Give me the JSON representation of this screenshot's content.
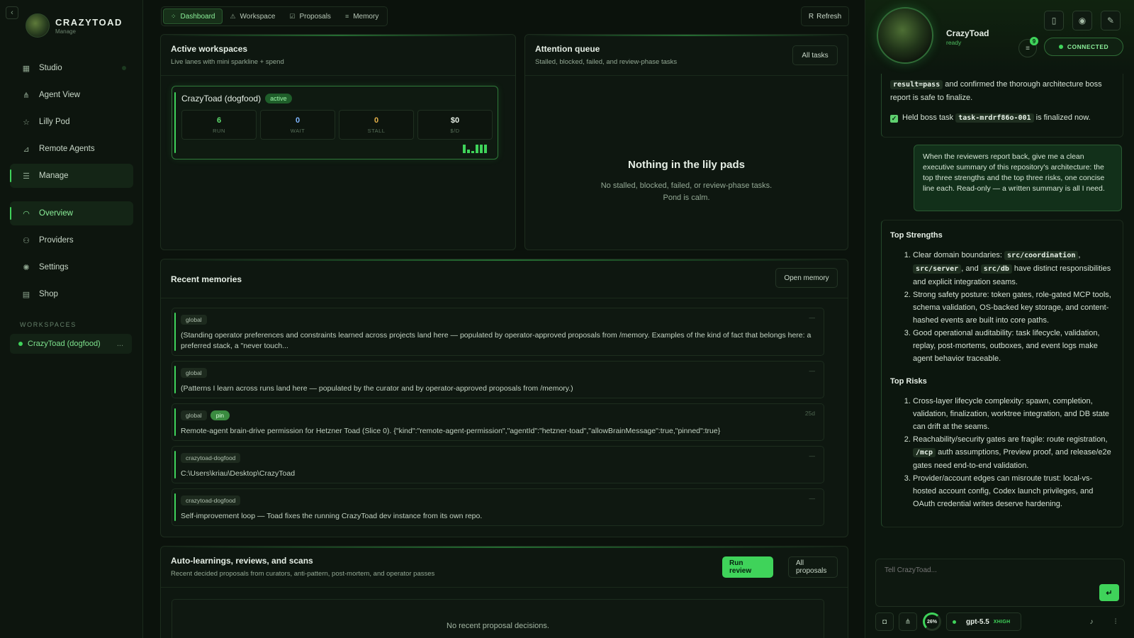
{
  "sidebar": {
    "collapse_icon": "chevron-left-icon",
    "brand": {
      "name": "CRAZYTOAD",
      "subtitle": "Manage"
    },
    "nav_top": [
      {
        "label": "Studio",
        "icon": "grid-icon"
      },
      {
        "label": "Agent View",
        "icon": "nodes-icon"
      },
      {
        "label": "Lilly Pod",
        "icon": "star-icon"
      },
      {
        "label": "Remote Agents",
        "icon": "antenna-icon"
      },
      {
        "label": "Manage",
        "icon": "sliders-icon"
      }
    ],
    "nav_bottom": [
      {
        "label": "Overview",
        "icon": "gauge-icon"
      },
      {
        "label": "Providers",
        "icon": "users-icon"
      },
      {
        "label": "Settings",
        "icon": "gear-icon"
      },
      {
        "label": "Shop",
        "icon": "store-icon"
      }
    ],
    "workspaces_label": "WORKSPACES",
    "workspace_item": {
      "label": "CrazyToad (dogfood)",
      "more": "..."
    }
  },
  "tabs": [
    {
      "label": "Dashboard",
      "icon": "dashboard-icon",
      "active": true
    },
    {
      "label": "Workspace",
      "icon": "workspace-icon",
      "active": false
    },
    {
      "label": "Proposals",
      "icon": "checkbox-icon",
      "active": false
    },
    {
      "label": "Memory",
      "icon": "list-icon",
      "active": false
    }
  ],
  "refresh_label": "Refresh",
  "active_workspaces": {
    "title": "Active workspaces",
    "subtitle": "Live lanes with mini sparkline + spend",
    "card": {
      "name": "CrazyToad (dogfood)",
      "status": "active",
      "stats": [
        {
          "value": "6",
          "label": "RUN",
          "color": "#5fe06f"
        },
        {
          "value": "0",
          "label": "WAIT",
          "color": "#7fb6ff"
        },
        {
          "value": "0",
          "label": "STALL",
          "color": "#e6b14a"
        },
        {
          "value": "$0",
          "label": "$/D",
          "color": "#e6efe6"
        }
      ]
    }
  },
  "attention_queue": {
    "title": "Attention queue",
    "subtitle": "Stalled, blocked, failed, and review-phase tasks",
    "button": "All tasks",
    "empty_title": "Nothing in the lily pads",
    "empty_line1": "No stalled, blocked, failed, or review-phase tasks.",
    "empty_line2": "Pond is calm."
  },
  "recent_memories": {
    "title": "Recent memories",
    "button": "Open memory",
    "items": [
      {
        "tags": [
          "global"
        ],
        "pin": "",
        "meta": "—",
        "text": "(Standing operator preferences and constraints learned across projects land here — populated by operator-approved proposals from /memory. Examples of the kind of fact that belongs here: a preferred stack, a \"never touch..."
      },
      {
        "tags": [
          "global"
        ],
        "pin": "",
        "meta": "—",
        "text": "(Patterns I learn across runs land here — populated by the curator and by operator-approved proposals from /memory.)"
      },
      {
        "tags": [
          "global"
        ],
        "pin": "pin",
        "meta": "25d",
        "text": "Remote-agent brain-drive permission for Hetzner Toad (Slice 0). {\"kind\":\"remote-agent-permission\",\"agentId\":\"hetzner-toad\",\"allowBrainMessage\":true,\"pinned\":true}"
      },
      {
        "tags": [
          "crazytoad-dogfood"
        ],
        "pin": "",
        "meta": "—",
        "text": "C:\\Users\\kriau\\Desktop\\CrazyToad"
      },
      {
        "tags": [
          "crazytoad-dogfood"
        ],
        "pin": "",
        "meta": "—",
        "text": "Self-improvement loop — Toad fixes the running CrazyToad dev instance from its own repo."
      }
    ]
  },
  "auto_learnings": {
    "title": "Auto-learnings, reviews, and scans",
    "subtitle": "Recent decided proposals from curators, anti-pattern, post-mortem, and operator passes",
    "run_button": "Run review",
    "all_button": "All proposals",
    "empty": "No recent proposal decisions."
  },
  "chat": {
    "agent_name": "CrazyToad",
    "agent_status": "ready",
    "badge_count": "9",
    "connection": "CONNECTED",
    "prev": {
      "code1": "result=pass",
      "text1": " and confirmed the thorough architecture boss report is safe to finalize.",
      "text2": "Held boss task ",
      "code2": "task-mrdrf86o-001",
      "text3": " is finalized now."
    },
    "user_message": "When the reviewers report back, give me a clean executive summary of this repository's architecture: the top three strengths and the top three risks, one concise line each. Read-only — a written summary is all I need.",
    "reply": {
      "strengths_heading": "Top Strengths",
      "s1": {
        "a": "Clear domain boundaries: ",
        "c1": "src/coordination",
        "b": ", ",
        "c2": "src/server",
        "d": ", and ",
        "c3": "src/db",
        "e": " have distinct responsibilities and explicit integration seams."
      },
      "s2": "Strong safety posture: token gates, role-gated MCP tools, schema validation, OS-backed key storage, and content-hashed events are built into core paths.",
      "s3": "Good operational auditability: task lifecycle, validation, replay, post-mortems, outboxes, and event logs make agent behavior traceable.",
      "risks_heading": "Top Risks",
      "r1": "Cross-layer lifecycle complexity: spawn, completion, validation, finalization, worktree integration, and DB state can drift at the seams.",
      "r2": {
        "a": "Reachability/security gates are fragile: route registration, ",
        "c": "/mcp",
        "b": " auth assumptions, Preview proof, and release/e2e gates need end-to-end validation."
      },
      "r3": "Provider/account edges can misroute trust: local-vs-hosted account config, Codex launch privileges, and OAuth credential writes deserve hardening."
    },
    "composer_placeholder": "Tell CrazyToad...",
    "context_pct": "26%",
    "model": "gpt-5.5",
    "effort": "XHIGH"
  }
}
